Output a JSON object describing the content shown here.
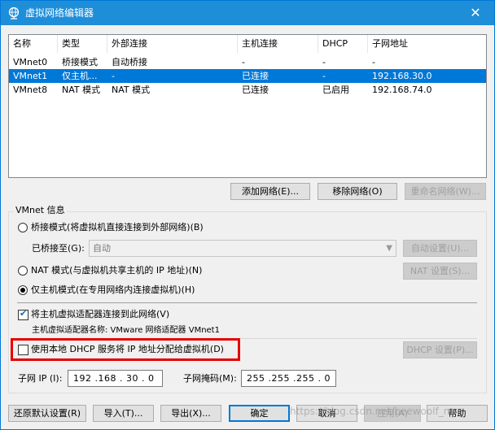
{
  "window": {
    "title": "虚拟网络编辑器",
    "close": "✕"
  },
  "table": {
    "columns": [
      "名称",
      "类型",
      "外部连接",
      "主机连接",
      "DHCP",
      "子网地址"
    ],
    "rows": [
      [
        "VMnet0",
        "桥接模式",
        "自动桥接",
        "-",
        "-",
        "-"
      ],
      [
        "VMnet1",
        "仅主机...",
        "-",
        "已连接",
        "-",
        "192.168.30.0"
      ],
      [
        "VMnet8",
        "NAT 模式",
        "NAT 模式",
        "已连接",
        "已启用",
        "192.168.74.0"
      ]
    ],
    "selected_row": 1
  },
  "network_buttons": {
    "add": "添加网络(E)...",
    "remove": "移除网络(O)",
    "rename": "重命名网络(W)..."
  },
  "vmnet_info": {
    "title": "VMnet 信息",
    "bridged_label": "桥接模式(将虚拟机直接连接到外部网络)(B)",
    "bridged_to_label": "已桥接至(G):",
    "bridged_to_value": "自动",
    "auto_settings": "自动设置(U)...",
    "nat_label": "NAT 模式(与虚拟机共享主机的 IP 地址)(N)",
    "nat_settings": "NAT 设置(S)...",
    "hostonly_label": "仅主机模式(在专用网络内连接虚拟机)(H)",
    "selected_mode": "hostonly",
    "connect_adapter_label": "将主机虚拟适配器连接到此网络(V)",
    "connect_adapter_checked": true,
    "adapter_name": "主机虚拟适配器名称: VMware 网络适配器 VMnet1",
    "dhcp_label": "使用本地 DHCP 服务将 IP 地址分配给虚拟机(D)",
    "dhcp_checked": false,
    "dhcp_settings": "DHCP 设置(P)...",
    "subnet_ip_label": "子网 IP (I):",
    "subnet_ip_value": "192 .168 . 30 . 0",
    "subnet_mask_label": "子网掩码(M):",
    "subnet_mask_value": "255 .255 .255 . 0"
  },
  "footer": {
    "restore": "还原默认设置(R)",
    "import": "导入(T)...",
    "export": "导出(X)...",
    "ok": "确定",
    "cancel": "取消",
    "apply": "应用(A)",
    "help": "帮助"
  },
  "watermark": "https://blog.csdn.net/beewoolf_ne",
  "colors": {
    "titlebar": "#1e8ed9",
    "selection": "#0078d7",
    "highlight_box": "#e60000"
  }
}
